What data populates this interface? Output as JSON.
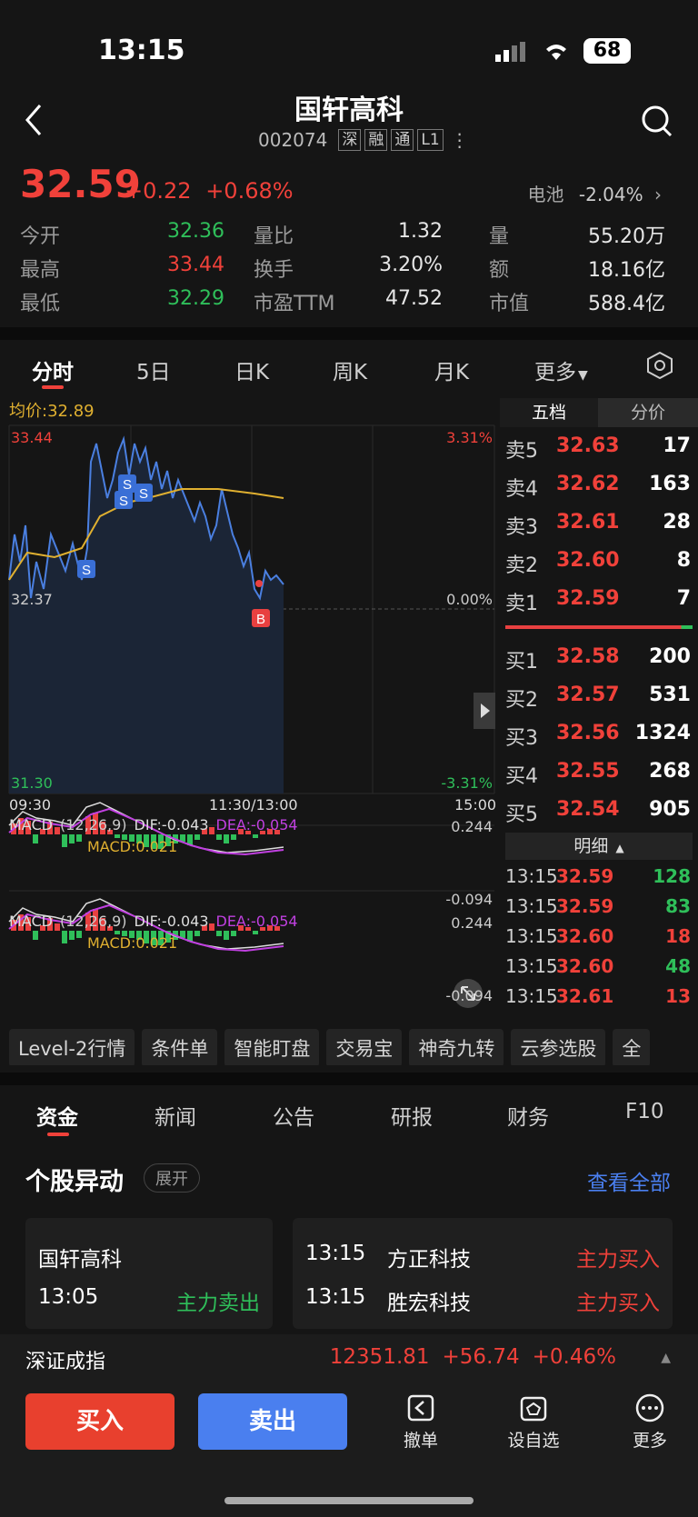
{
  "status": {
    "time": "13:15",
    "battery": "68"
  },
  "header": {
    "title": "国轩高科",
    "code": "002074",
    "tags": [
      "深",
      "融",
      "通",
      "L1"
    ]
  },
  "quote": {
    "price": "32.59",
    "change": "+0.22",
    "change_pct": "+0.68%",
    "sector_name": "电池",
    "sector_pct": "-2.04%",
    "open_label": "今开",
    "open": "32.36",
    "high_label": "最高",
    "high": "33.44",
    "low_label": "最低",
    "low": "32.29",
    "vr_label": "量比",
    "vr": "1.32",
    "turnover_label": "换手",
    "turnover": "3.20%",
    "pe_label": "市盈TTM",
    "pe": "47.52",
    "vol_label": "量",
    "vol": "55.20万",
    "amount_label": "额",
    "amount": "18.16亿",
    "mcap_label": "市值",
    "mcap": "588.4亿"
  },
  "chart_tabs": [
    "分时",
    "5日",
    "日K",
    "周K",
    "月K",
    "更多"
  ],
  "intraday": {
    "avg_label": "均价:32.89",
    "y_high": "33.44",
    "y_ref": "32.37",
    "y_low": "31.30",
    "pct_high": "3.31%",
    "pct_ref": "0.00%",
    "pct_low": "-3.31%",
    "t_start": "09:30",
    "t_mid": "11:30/13:00",
    "t_end": "15:00",
    "marker_sell": "S",
    "marker_buy": "B"
  },
  "macd": {
    "label": "MACD",
    "params": "(12,26,9)",
    "dif": "DIF:-0.043",
    "dea": "DEA:-0.054",
    "macd": "MACD:0.021",
    "top": "0.244",
    "bottom": "-0.094"
  },
  "orderbook": {
    "tabs": [
      "五档",
      "分价"
    ],
    "asks": [
      {
        "label": "卖5",
        "price": "32.63",
        "vol": "17"
      },
      {
        "label": "卖4",
        "price": "32.62",
        "vol": "163"
      },
      {
        "label": "卖3",
        "price": "32.61",
        "vol": "28"
      },
      {
        "label": "卖2",
        "price": "32.60",
        "vol": "8"
      },
      {
        "label": "卖1",
        "price": "32.59",
        "vol": "7"
      }
    ],
    "bids": [
      {
        "label": "买1",
        "price": "32.58",
        "vol": "200"
      },
      {
        "label": "买2",
        "price": "32.57",
        "vol": "531"
      },
      {
        "label": "买3",
        "price": "32.56",
        "vol": "1324"
      },
      {
        "label": "买4",
        "price": "32.55",
        "vol": "268"
      },
      {
        "label": "买5",
        "price": "32.54",
        "vol": "905"
      }
    ],
    "detail_title": "明细",
    "details": [
      {
        "time": "13:15",
        "price": "32.59",
        "vol": "128",
        "color": "#2fbf5a"
      },
      {
        "time": "13:15",
        "price": "32.59",
        "vol": "83",
        "color": "#2fbf5a"
      },
      {
        "time": "13:15",
        "price": "32.60",
        "vol": "18",
        "color": "#f0413a"
      },
      {
        "time": "13:15",
        "price": "32.60",
        "vol": "48",
        "color": "#2fbf5a"
      },
      {
        "time": "13:15",
        "price": "32.61",
        "vol": "13",
        "color": "#f0413a"
      }
    ]
  },
  "chips": [
    "Level-2行情",
    "条件单",
    "智能盯盘",
    "交易宝",
    "神奇九转",
    "云参选股",
    "全"
  ],
  "bottom_tabs": [
    "资金",
    "新闻",
    "公告",
    "研报",
    "财务",
    "F10"
  ],
  "movement": {
    "title": "个股异动",
    "expand": "展开",
    "view_all": "查看全部",
    "left": {
      "name": "国轩高科",
      "time": "13:05",
      "event": "主力卖出"
    },
    "right": [
      {
        "time": "13:15",
        "name": "方正科技",
        "event": "主力买入"
      },
      {
        "time": "13:15",
        "name": "胜宏科技",
        "event": "主力买入"
      }
    ]
  },
  "index_bar": {
    "name": "深证成指",
    "value": "12351.81",
    "change": "+56.74",
    "pct": "+0.46%"
  },
  "actions": {
    "buy": "买入",
    "sell": "卖出",
    "cancel": "撤单",
    "watch": "设自选",
    "more": "更多"
  },
  "colors": {
    "up": "#f0413a",
    "down": "#2fbf5a",
    "price_line": "#4a7fe0",
    "avg_line": "#e0b030",
    "sell_btn": "#4a7fef",
    "buy_btn": "#e8402e",
    "link": "#4a7fef"
  }
}
